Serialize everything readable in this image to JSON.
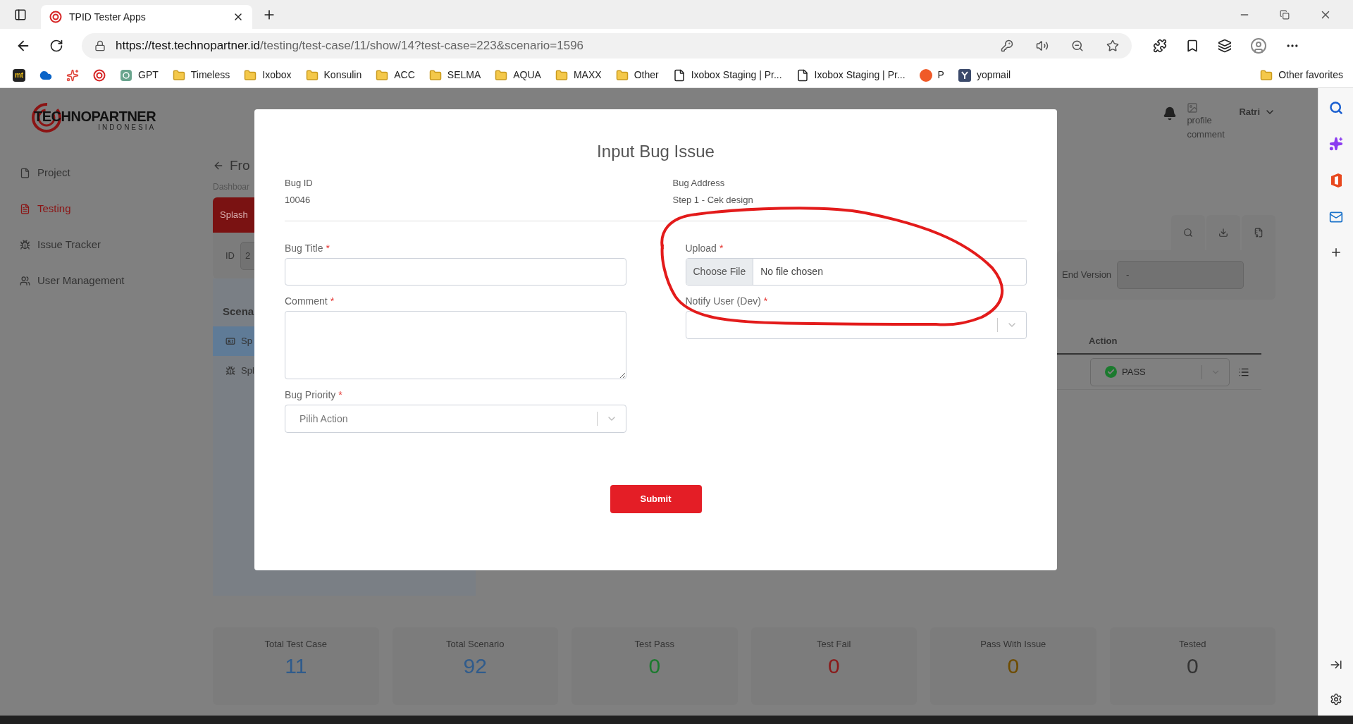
{
  "browser": {
    "tab_title": "TPID Tester Apps",
    "url_host": "https://test.technopartner.id",
    "url_path": "/testing/test-case/11/show/14?test-case=223&scenario=1596",
    "bookmarks": [
      {
        "kind": "logo",
        "label": "mt"
      },
      {
        "kind": "cloud"
      },
      {
        "kind": "app"
      },
      {
        "kind": "tpid"
      },
      {
        "kind": "gpt",
        "label": "GPT"
      },
      {
        "kind": "folder",
        "label": "Timeless"
      },
      {
        "kind": "folder",
        "label": "Ixobox"
      },
      {
        "kind": "folder",
        "label": "Konsulin"
      },
      {
        "kind": "folder",
        "label": "ACC"
      },
      {
        "kind": "folder",
        "label": "SELMA"
      },
      {
        "kind": "folder",
        "label": "AQUA"
      },
      {
        "kind": "folder",
        "label": "MAXX"
      },
      {
        "kind": "folder",
        "label": "Other"
      },
      {
        "kind": "page",
        "label": "Ixobox Staging | Pr..."
      },
      {
        "kind": "page",
        "label": "Ixobox Staging | Pr..."
      },
      {
        "kind": "orange",
        "label": "P"
      },
      {
        "kind": "y",
        "label": "yopmail"
      }
    ],
    "other_favorites": "Other favorites"
  },
  "sidebar": {
    "items": [
      {
        "label": "Project",
        "kind": "file",
        "selected": false
      },
      {
        "label": "Testing",
        "kind": "document",
        "selected": true
      },
      {
        "label": "Issue Tracker",
        "kind": "bug",
        "selected": false
      },
      {
        "label": "User Management",
        "kind": "users",
        "selected": false
      }
    ]
  },
  "logo": {
    "name": "TECHNOPARTNER",
    "subtitle": "INDONESIA"
  },
  "header": {
    "image_alt": "profile comment",
    "user": "Ratri"
  },
  "background": {
    "back_title": "Fro",
    "breadcrumb": "Dashboar",
    "card_tab": "Splash",
    "id_label": "ID",
    "id_value": "2",
    "end_version_label": "End Version",
    "end_version_value": "-",
    "scenario_heading": "Scena",
    "scenario_items": [
      {
        "label": "Sp",
        "kind": "card",
        "selected": true
      },
      {
        "label": "Spl",
        "kind": "bug",
        "selected": false
      }
    ],
    "action_header": "Action",
    "action_value": "PASS"
  },
  "stats": [
    {
      "label": "Total Test Case",
      "value": "11",
      "color": "#2f5b8c"
    },
    {
      "label": "Total Scenario",
      "value": "92",
      "color": "#2f5b8c"
    },
    {
      "label": "Test Pass",
      "value": "0",
      "color": "#1b7a2e"
    },
    {
      "label": "Test Fail",
      "value": "0",
      "color": "#8a1a1a"
    },
    {
      "label": "Pass With Issue",
      "value": "0",
      "color": "#6e4c00"
    },
    {
      "label": "Tested",
      "value": "0",
      "color": "#333333"
    }
  ],
  "modal": {
    "title": "Input Bug Issue",
    "info": [
      {
        "label": "Bug ID",
        "value": "10046"
      },
      {
        "label": "Bug Address",
        "value": "Step 1 - Cek design"
      }
    ],
    "left_fields": [
      {
        "kind": "text",
        "label": "Bug Title",
        "required_mark": "*"
      },
      {
        "kind": "textarea",
        "label": "Comment",
        "required_mark": "*"
      },
      {
        "kind": "select",
        "label": "Bug Priority",
        "required_mark": "*",
        "placeholder": "Pilih Action"
      }
    ],
    "right_fields": [
      {
        "kind": "file",
        "label": "Upload",
        "required_mark": "*",
        "button": "Choose File",
        "status": "No file chosen"
      },
      {
        "kind": "select",
        "label": "Notify User (Dev)",
        "required_mark": "*"
      }
    ],
    "submit": "Submit"
  }
}
